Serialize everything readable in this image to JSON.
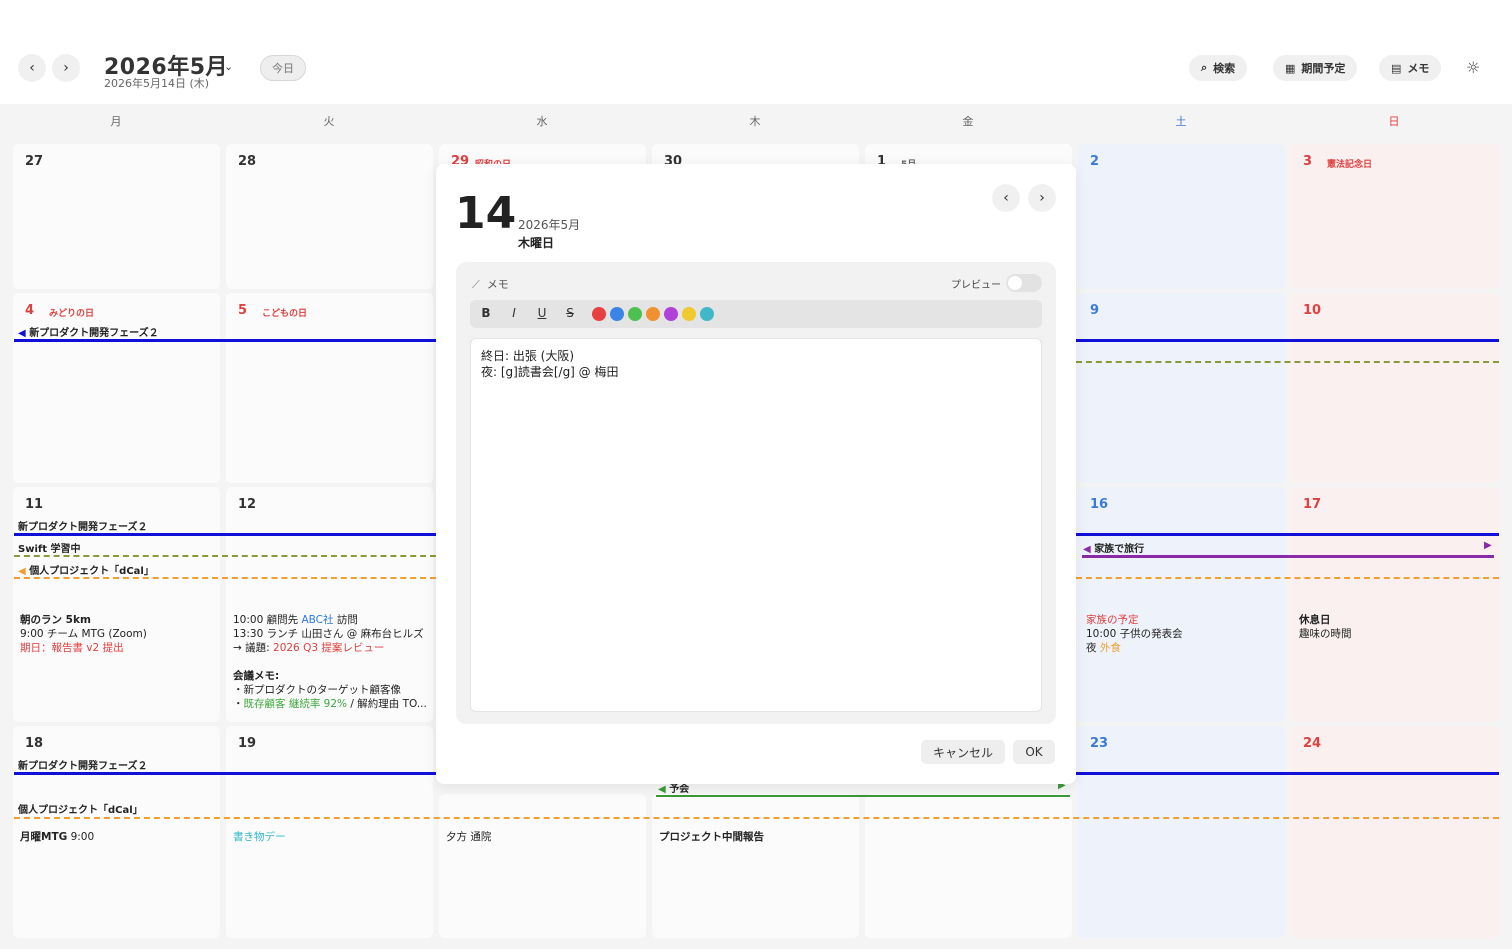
{
  "header": {
    "month_title": "2026年5月",
    "date_sub": "2026年5月14日 (木)",
    "today_label": "今日",
    "search_label": "検索",
    "period_label": "期間予定",
    "memo_label": "メモ"
  },
  "weekdays": [
    "月",
    "火",
    "水",
    "木",
    "金",
    "土",
    "日"
  ],
  "weeks": [
    {
      "days": [
        "27",
        "28",
        "29",
        "30",
        "1",
        "2",
        "3"
      ]
    },
    {
      "days": [
        "4",
        "5",
        "",
        "",
        "",
        "9",
        "10"
      ]
    },
    {
      "days": [
        "11",
        "12",
        "",
        "",
        "",
        "16",
        "17"
      ]
    },
    {
      "days": [
        "18",
        "19",
        "",
        "",
        "",
        "23",
        "24"
      ]
    }
  ],
  "holidays": {
    "d29": "昭和の日",
    "d1": "5月",
    "d3": "憲法記念日",
    "d4": "みどりの日",
    "d5": "こどもの日"
  },
  "bars": {
    "proj_w2": "新プロダクト開発フェーズ２",
    "proj_w3": "新プロダクト開発フェーズ２",
    "proj_w4": "新プロダクト開発フェーズ２",
    "swift": "Swift 学習中",
    "dcal_w3": "個人プロジェクト「dCal」",
    "dcal_w4": "個人プロジェクト「dCal」",
    "travel": "家族で旅行",
    "trip_w4": "予会"
  },
  "notes": {
    "d11": {
      "l1": "朝のラン 5km",
      "l2": "9:00 チーム MTG (Zoom)",
      "l3": "期日：報告書 v2 提出"
    },
    "d12": {
      "l1a": "10:00 顧問先 ",
      "l1b": "ABC社",
      "l1c": " 訪問",
      "l2": "13:30 ランチ 山田さん @ 麻布台ヒルズ",
      "l3a": "→ 議題: ",
      "l3b": "2026 Q3 提案レビュー",
      "l4": "会議メモ:",
      "l5": "・新プロダクトのターゲット顧客像",
      "l6a": "・",
      "l6b": "既存顧客 継続率 92%",
      "l6c": " / 解約理由 TO..."
    },
    "d16": {
      "l1": "家族の予定",
      "l2": "10:00 子供の発表会",
      "l3a": "夜 ",
      "l3b": "外食"
    },
    "d17": {
      "l1": "休息日",
      "l2": "趣味の時間"
    },
    "d18": {
      "l1a": "月曜MTG",
      "l1b": " 9:00"
    },
    "d19": {
      "l1": "書き物デー"
    },
    "d20": {
      "l1": "夕方 通院"
    },
    "d21": {
      "l1": "プロジェクト中間報告"
    }
  },
  "modal": {
    "day": "14",
    "year_month": "2026年5月",
    "weekday": "木曜日",
    "memo_head": "メモ",
    "preview_label": "プレビュー",
    "fmt_bold": "B",
    "fmt_italic": "I",
    "fmt_underline": "U",
    "fmt_strike": "S",
    "swatches": [
      "#e84040",
      "#3a84e8",
      "#4cc050",
      "#f09030",
      "#b040d8",
      "#f0c830",
      "#40b8c8"
    ],
    "editor_line1": "終日: 出張 (大阪)",
    "editor_line2": "夜: [g]読書会[/g] @ 梅田",
    "cancel_label": "キャンセル",
    "ok_label": "OK"
  }
}
